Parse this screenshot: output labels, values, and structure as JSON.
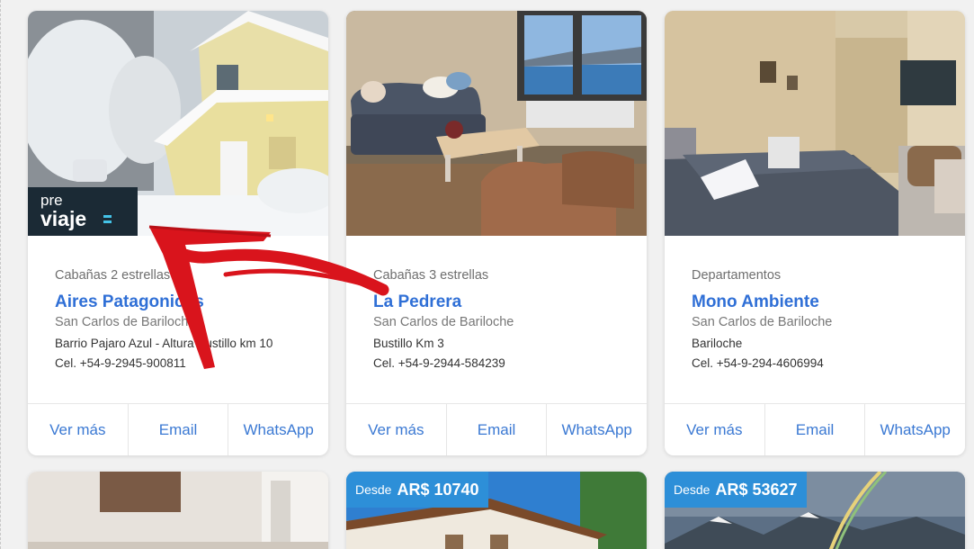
{
  "listings": [
    {
      "category": "Cabañas 2 estrellas",
      "name": "Aires Patagonicos",
      "city": "San Carlos de Bariloche",
      "address": "Barrio Pajaro Azul - Altura Bustillo km 10",
      "phone": "Cel. +54-9-2945-900811",
      "photo_label": "snowy cabin in winter",
      "overlay_logo": {
        "line1": "pre",
        "line2": "viaje"
      }
    },
    {
      "category": "Cabañas 3 estrellas",
      "name": "La Pedrera",
      "city": "San Carlos de Bariloche",
      "address": "Bustillo Km 3",
      "phone": "Cel. +54-9-2944-584239",
      "photo_label": "living room with lake view"
    },
    {
      "category": "Departamentos",
      "name": "Mono Ambiente",
      "city": "San Carlos de Bariloche",
      "address": "Bariloche",
      "phone": "Cel. +54-9-294-4606994",
      "photo_label": "studio apartment bedroom"
    }
  ],
  "actions": {
    "more": "Ver más",
    "email": "Email",
    "whatsapp": "WhatsApp"
  },
  "next_row": [
    {
      "photo_label": "interior room"
    },
    {
      "price_prefix": "Desde",
      "price": "AR$ 10740",
      "photo_label": "house exterior"
    },
    {
      "price_prefix": "Desde",
      "price": "AR$ 53627",
      "photo_label": "mountains and rainbow"
    }
  ],
  "colors": {
    "link_blue": "#2f6fd6",
    "action_blue": "#3b79d3",
    "price_badge": "#2d8fd8",
    "annotation_arrow": "#d9141c"
  }
}
